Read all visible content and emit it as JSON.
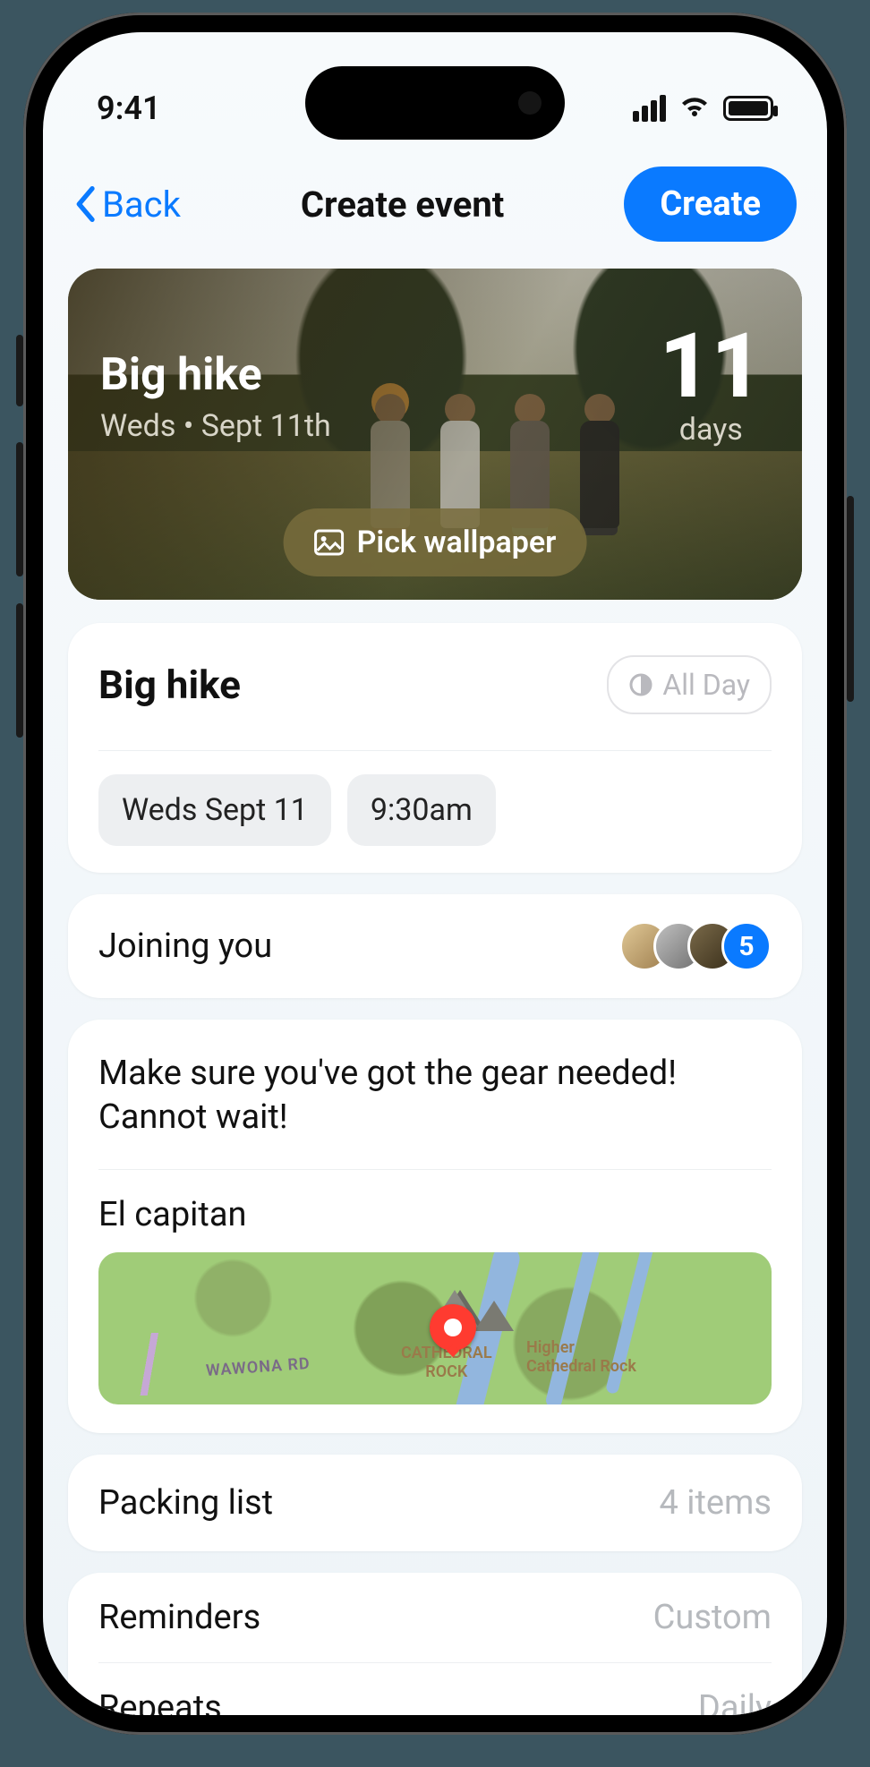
{
  "status": {
    "time": "9:41"
  },
  "nav": {
    "back": "Back",
    "title": "Create event",
    "create": "Create"
  },
  "hero": {
    "title": "Big hike",
    "subtitle": "Weds • Sept 11th",
    "count_number": "11",
    "count_label": "days",
    "pick_wallpaper": "Pick wallpaper"
  },
  "title_card": {
    "title": "Big hike",
    "all_day": "All Day",
    "date_chip": "Weds Sept 11",
    "time_chip": "9:30am"
  },
  "joining": {
    "label": "Joining you",
    "extra_count": "5"
  },
  "notes": {
    "text": "Make sure you've got the gear needed! Cannot wait!",
    "location_label": "El capitan",
    "map": {
      "road": "WAWONA RD",
      "poi1_top": "CATHEDRAL",
      "poi1_bot": "ROCK",
      "poi2_top": "Higher",
      "poi2_bot": "Cathedral Rock"
    }
  },
  "packing": {
    "label": "Packing list",
    "value": "4 items"
  },
  "reminders": {
    "label": "Reminders",
    "value": "Custom"
  },
  "repeats": {
    "label": "Repeats",
    "value": "Daily"
  }
}
